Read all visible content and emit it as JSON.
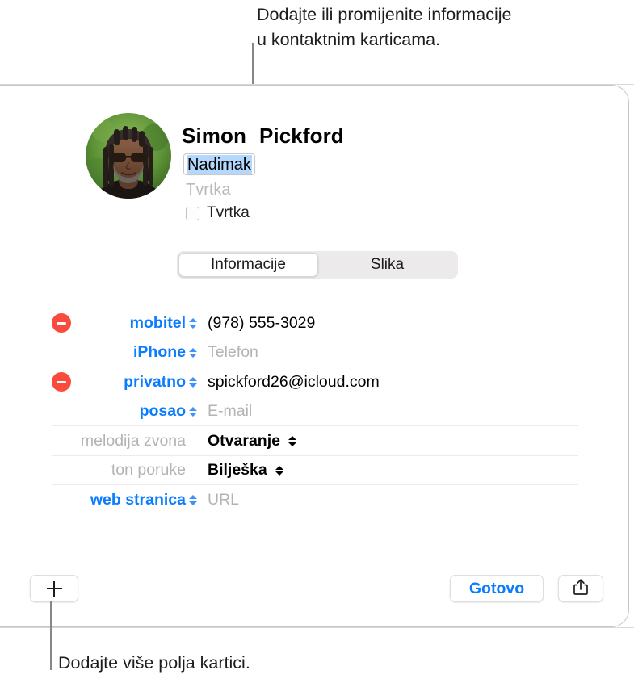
{
  "callouts": {
    "top": "Dodajte ili promijenite informacije\nu kontaktnim karticama.",
    "bottom": "Dodajte više polja kartici."
  },
  "card": {
    "avatar_alt": "contact-photo",
    "first_name": "Simon",
    "last_name": "Pickford",
    "nickname_value": "Nadimak",
    "company_placeholder": "Tvrtka",
    "company_checkbox_label": "Tvrtka",
    "company_checkbox_checked": false,
    "tabs": [
      {
        "label": "Informacije",
        "active": true
      },
      {
        "label": "Slika",
        "active": false
      }
    ],
    "fields": [
      {
        "removable": true,
        "label": "mobitel",
        "label_style": "blue",
        "stepper": true,
        "value": "(978) 555-3029",
        "value_style": "filled",
        "value_stepper": false,
        "divider_after": false
      },
      {
        "removable": false,
        "label": "iPhone",
        "label_style": "blue",
        "stepper": true,
        "value": "Telefon",
        "value_style": "placeholder",
        "value_stepper": false,
        "divider_after": true
      },
      {
        "removable": true,
        "label": "privatno",
        "label_style": "blue",
        "stepper": true,
        "value": "spickford26@icloud.com",
        "value_style": "filled",
        "value_stepper": false,
        "divider_after": false
      },
      {
        "removable": false,
        "label": "posao",
        "label_style": "blue",
        "stepper": true,
        "value": "E-mail",
        "value_style": "placeholder",
        "value_stepper": false,
        "divider_after": true
      },
      {
        "removable": false,
        "label": "melodija zvona",
        "label_style": "gray",
        "stepper": false,
        "value": "Otvaranje",
        "value_style": "bold",
        "value_stepper": true,
        "divider_after": true
      },
      {
        "removable": false,
        "label": "ton poruke",
        "label_style": "gray",
        "stepper": false,
        "value": "Bilješka",
        "value_style": "bold",
        "value_stepper": true,
        "divider_after": true
      },
      {
        "removable": false,
        "label": "web stranica",
        "label_style": "blue",
        "stepper": true,
        "value": "URL",
        "value_style": "placeholder",
        "value_stepper": false,
        "divider_after": false
      }
    ],
    "toolbar": {
      "add_icon": "plus-icon",
      "done_label": "Gotovo",
      "share_icon": "share-icon"
    }
  },
  "colors": {
    "accent_blue": "#0a7cff",
    "remove_red": "#f94b3e",
    "selection_blue": "#b3d7fd",
    "placeholder_gray": "#b3b3b6",
    "divider": "#eceaec"
  }
}
